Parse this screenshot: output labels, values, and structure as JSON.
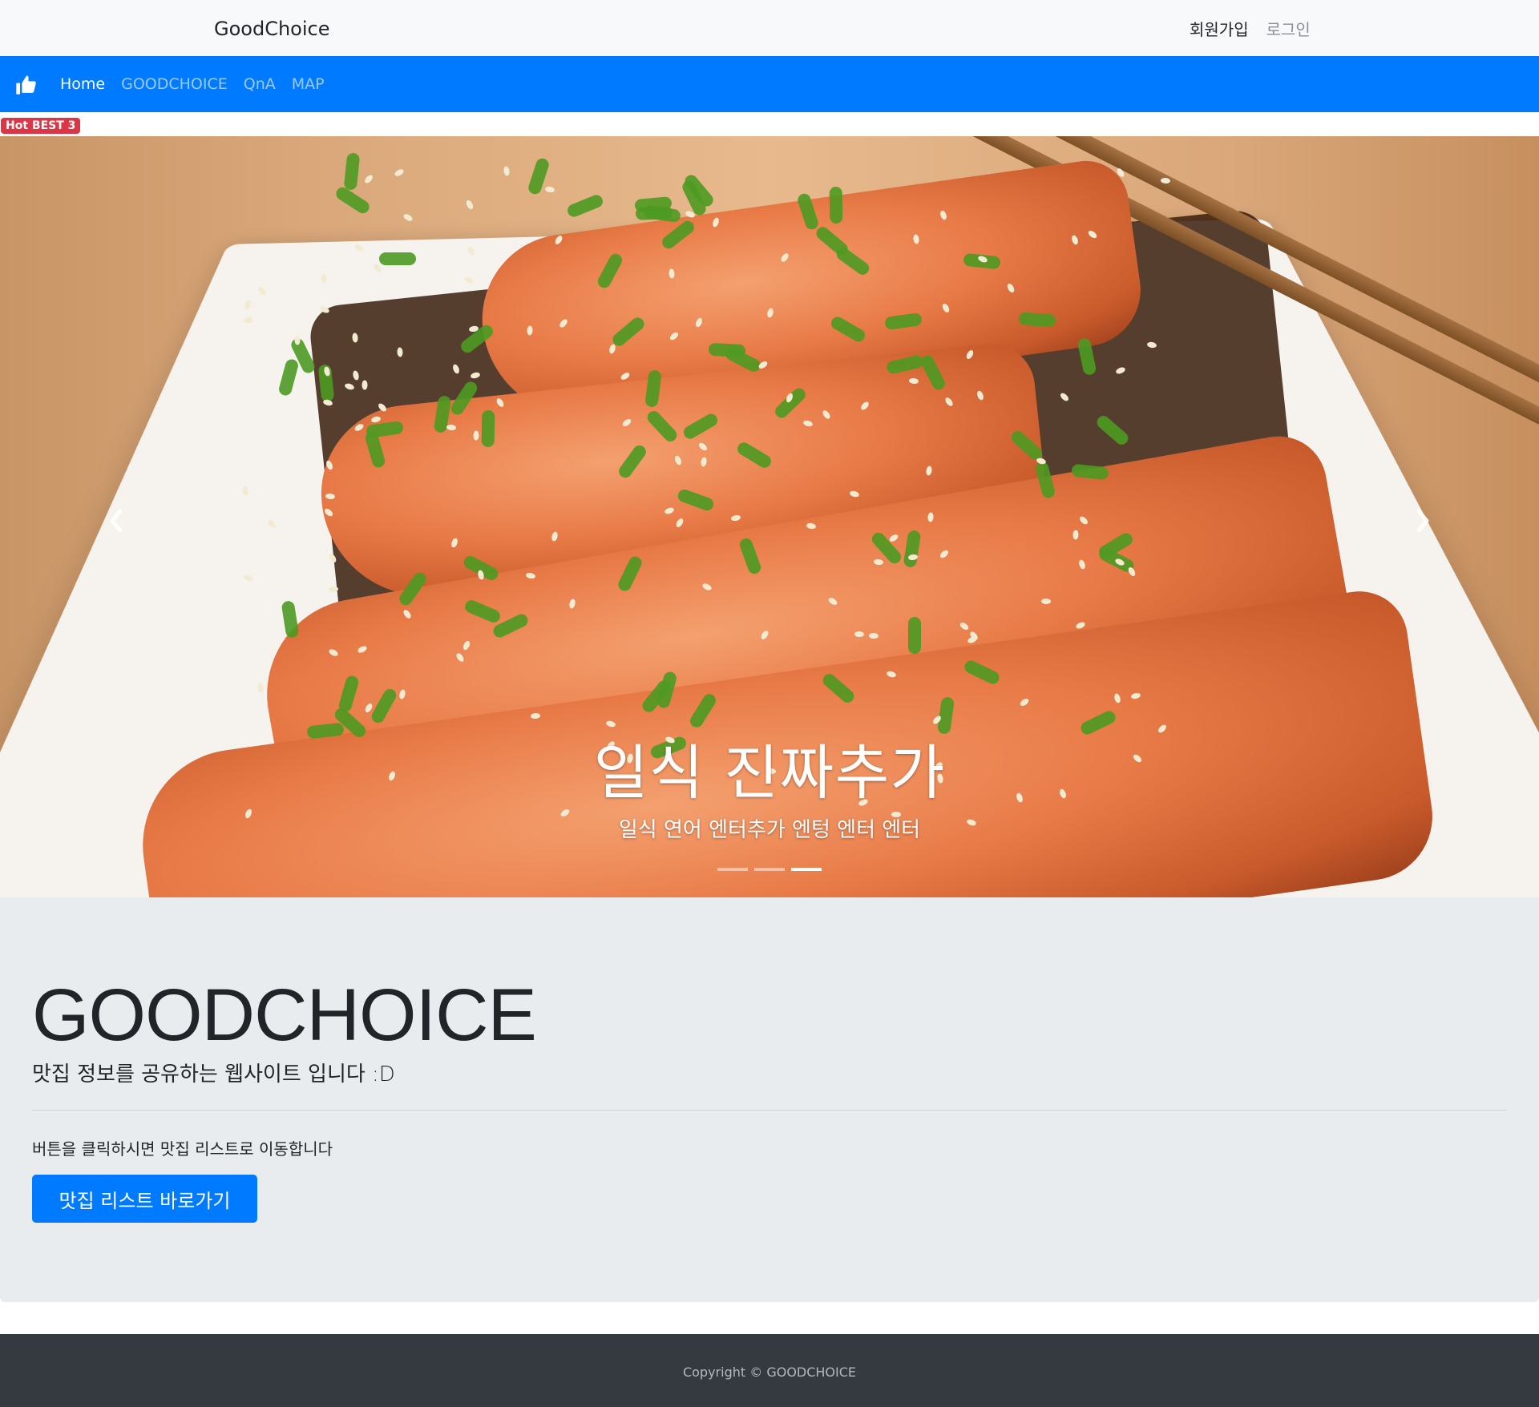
{
  "header": {
    "brand": "GoodChoice",
    "links": [
      "회원가입",
      "로그인"
    ]
  },
  "navbar": {
    "icon": "thumbs-up-icon",
    "items": [
      "Home",
      "GOODCHOICE",
      "QnA",
      "MAP"
    ]
  },
  "badge": "Hot BEST 3",
  "carousel": {
    "title": "일식 진짜추가",
    "subtitle": "일식 연어  엔터추가  엔텅 엔터 엔터",
    "slides": 3,
    "active": 3,
    "prev_icon": "chevron-left-icon",
    "next_icon": "chevron-right-icon"
  },
  "jumbotron": {
    "title": "GOODCHOICE",
    "lead": "맛집 정보를 공유하는 웹사이트 입니다 :D",
    "text": "버튼을 클릭하시면 맛집 리스트로 이동합니다",
    "button": "맛집 리스트 바로가기"
  },
  "footer": {
    "copyright": "Copyright © GOODCHOICE"
  },
  "colors": {
    "primary": "#007bff",
    "danger": "#dc3545",
    "footer": "#343a40",
    "jumbotron": "#e9ecef",
    "topbar": "#f8f9fa"
  }
}
